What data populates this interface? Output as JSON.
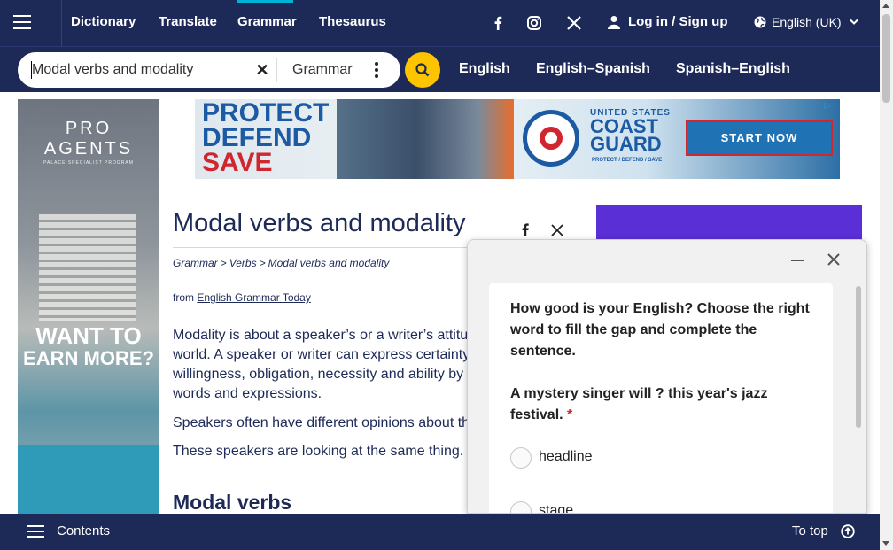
{
  "nav": {
    "links": [
      "Dictionary",
      "Translate",
      "Grammar",
      "Thesaurus"
    ],
    "active": "Grammar",
    "login_label": "Log in / Sign up",
    "language_label": "English (UK)"
  },
  "search": {
    "query": "Modal verbs and modality",
    "dictionary_label": "Grammar",
    "dict_links": [
      "English",
      "English–Spanish",
      "Spanish–English"
    ]
  },
  "ads": {
    "left": {
      "brand_line1": "PRO",
      "brand_line2": "AGENTS",
      "brand_line3": "PALACE SPECIALIST PROGRAM",
      "cta_line1": "WANT TO",
      "cta_line2": "EARN MORE?"
    },
    "banner": {
      "word1": "PROTECT",
      "word2": "DEFEND",
      "word3": "SAVE",
      "org_small": "UNITED STATES",
      "org_line1": "COAST",
      "org_line2": "GUARD",
      "tagline": "PROTECT / DEFEND / SAVE",
      "cta": "START NOW"
    }
  },
  "article": {
    "title": "Modal verbs and modality",
    "breadcrumb": [
      "Grammar",
      ">",
      "Verbs",
      ">",
      "Modal verbs and modality"
    ],
    "from_prefix": "from",
    "from_source": "English Grammar Today",
    "para1_lines": [
      "Modality is about a speaker’s or a writer’s attitu",
      "world. A speaker or writer can express certainty",
      "willingness, obligation, necessity and ability by",
      "words and expressions."
    ],
    "para2": "Speakers often have different opinions about th",
    "para3": "These speakers are looking at the same thing.",
    "section_heading": "Modal verbs"
  },
  "quiz": {
    "question1": "How good is your English? Choose the right word to fill the gap and complete the sentence.",
    "question2": "A mystery singer will ? this year's jazz festival.",
    "required_mark": "*",
    "options": [
      "headline",
      "stage"
    ]
  },
  "bottombar": {
    "contents_label": "Contents",
    "totop_label": "To top"
  },
  "colors": {
    "navy": "#1d2a57",
    "accent_yellow": "#fec400",
    "active_tab": "#00b3d6",
    "purple": "#5a2fd6"
  }
}
